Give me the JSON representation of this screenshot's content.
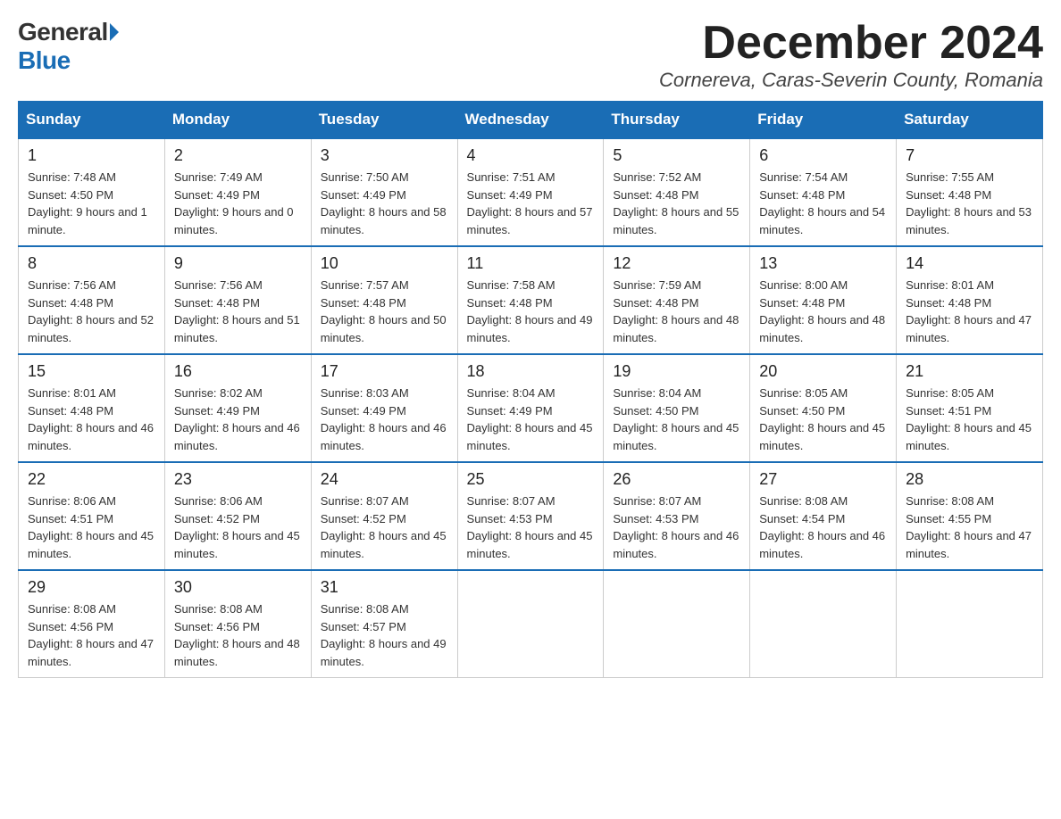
{
  "logo": {
    "line1": "General",
    "line2": "Blue"
  },
  "title": "December 2024",
  "location": "Cornereva, Caras-Severin County, Romania",
  "days": [
    "Sunday",
    "Monday",
    "Tuesday",
    "Wednesday",
    "Thursday",
    "Friday",
    "Saturday"
  ],
  "weeks": [
    [
      {
        "day": "1",
        "sunrise": "7:48 AM",
        "sunset": "4:50 PM",
        "daylight": "9 hours and 1 minute."
      },
      {
        "day": "2",
        "sunrise": "7:49 AM",
        "sunset": "4:49 PM",
        "daylight": "9 hours and 0 minutes."
      },
      {
        "day": "3",
        "sunrise": "7:50 AM",
        "sunset": "4:49 PM",
        "daylight": "8 hours and 58 minutes."
      },
      {
        "day": "4",
        "sunrise": "7:51 AM",
        "sunset": "4:49 PM",
        "daylight": "8 hours and 57 minutes."
      },
      {
        "day": "5",
        "sunrise": "7:52 AM",
        "sunset": "4:48 PM",
        "daylight": "8 hours and 55 minutes."
      },
      {
        "day": "6",
        "sunrise": "7:54 AM",
        "sunset": "4:48 PM",
        "daylight": "8 hours and 54 minutes."
      },
      {
        "day": "7",
        "sunrise": "7:55 AM",
        "sunset": "4:48 PM",
        "daylight": "8 hours and 53 minutes."
      }
    ],
    [
      {
        "day": "8",
        "sunrise": "7:56 AM",
        "sunset": "4:48 PM",
        "daylight": "8 hours and 52 minutes."
      },
      {
        "day": "9",
        "sunrise": "7:56 AM",
        "sunset": "4:48 PM",
        "daylight": "8 hours and 51 minutes."
      },
      {
        "day": "10",
        "sunrise": "7:57 AM",
        "sunset": "4:48 PM",
        "daylight": "8 hours and 50 minutes."
      },
      {
        "day": "11",
        "sunrise": "7:58 AM",
        "sunset": "4:48 PM",
        "daylight": "8 hours and 49 minutes."
      },
      {
        "day": "12",
        "sunrise": "7:59 AM",
        "sunset": "4:48 PM",
        "daylight": "8 hours and 48 minutes."
      },
      {
        "day": "13",
        "sunrise": "8:00 AM",
        "sunset": "4:48 PM",
        "daylight": "8 hours and 48 minutes."
      },
      {
        "day": "14",
        "sunrise": "8:01 AM",
        "sunset": "4:48 PM",
        "daylight": "8 hours and 47 minutes."
      }
    ],
    [
      {
        "day": "15",
        "sunrise": "8:01 AM",
        "sunset": "4:48 PM",
        "daylight": "8 hours and 46 minutes."
      },
      {
        "day": "16",
        "sunrise": "8:02 AM",
        "sunset": "4:49 PM",
        "daylight": "8 hours and 46 minutes."
      },
      {
        "day": "17",
        "sunrise": "8:03 AM",
        "sunset": "4:49 PM",
        "daylight": "8 hours and 46 minutes."
      },
      {
        "day": "18",
        "sunrise": "8:04 AM",
        "sunset": "4:49 PM",
        "daylight": "8 hours and 45 minutes."
      },
      {
        "day": "19",
        "sunrise": "8:04 AM",
        "sunset": "4:50 PM",
        "daylight": "8 hours and 45 minutes."
      },
      {
        "day": "20",
        "sunrise": "8:05 AM",
        "sunset": "4:50 PM",
        "daylight": "8 hours and 45 minutes."
      },
      {
        "day": "21",
        "sunrise": "8:05 AM",
        "sunset": "4:51 PM",
        "daylight": "8 hours and 45 minutes."
      }
    ],
    [
      {
        "day": "22",
        "sunrise": "8:06 AM",
        "sunset": "4:51 PM",
        "daylight": "8 hours and 45 minutes."
      },
      {
        "day": "23",
        "sunrise": "8:06 AM",
        "sunset": "4:52 PM",
        "daylight": "8 hours and 45 minutes."
      },
      {
        "day": "24",
        "sunrise": "8:07 AM",
        "sunset": "4:52 PM",
        "daylight": "8 hours and 45 minutes."
      },
      {
        "day": "25",
        "sunrise": "8:07 AM",
        "sunset": "4:53 PM",
        "daylight": "8 hours and 45 minutes."
      },
      {
        "day": "26",
        "sunrise": "8:07 AM",
        "sunset": "4:53 PM",
        "daylight": "8 hours and 46 minutes."
      },
      {
        "day": "27",
        "sunrise": "8:08 AM",
        "sunset": "4:54 PM",
        "daylight": "8 hours and 46 minutes."
      },
      {
        "day": "28",
        "sunrise": "8:08 AM",
        "sunset": "4:55 PM",
        "daylight": "8 hours and 47 minutes."
      }
    ],
    [
      {
        "day": "29",
        "sunrise": "8:08 AM",
        "sunset": "4:56 PM",
        "daylight": "8 hours and 47 minutes."
      },
      {
        "day": "30",
        "sunrise": "8:08 AM",
        "sunset": "4:56 PM",
        "daylight": "8 hours and 48 minutes."
      },
      {
        "day": "31",
        "sunrise": "8:08 AM",
        "sunset": "4:57 PM",
        "daylight": "8 hours and 49 minutes."
      },
      null,
      null,
      null,
      null
    ]
  ]
}
